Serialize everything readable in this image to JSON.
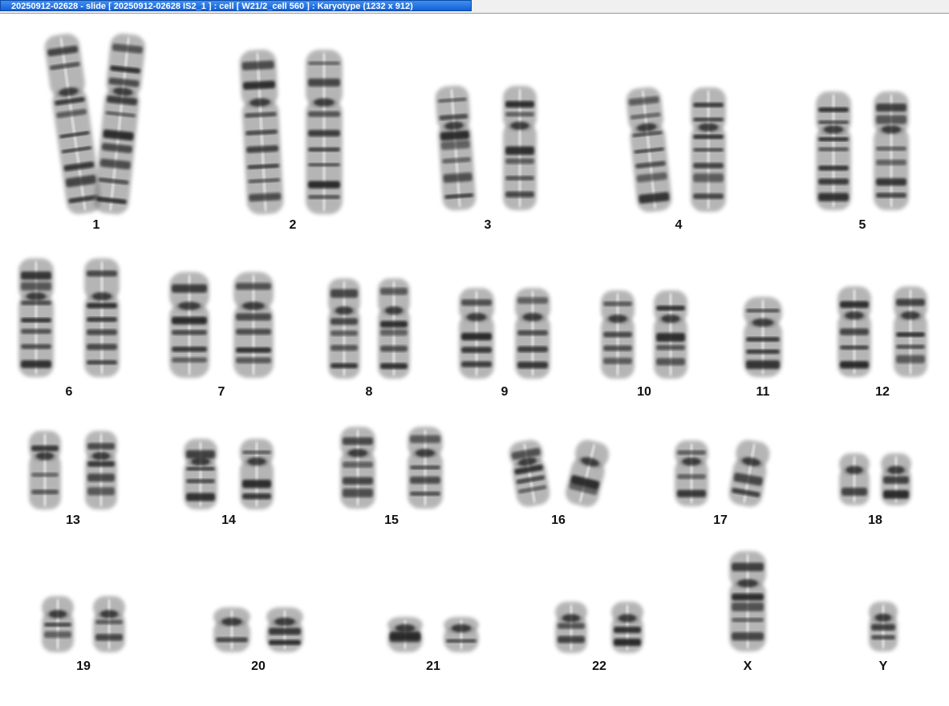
{
  "window": {
    "title": "20250912-02628 - slide [ 20250912-02628 IS2_1 ] : cell [ W21/2_cell 560 ] : Karyotype  (1232 x 912)"
  },
  "karyotype": {
    "chromosomes": [
      {
        "id": "1",
        "label": "1"
      },
      {
        "id": "2",
        "label": "2"
      },
      {
        "id": "3",
        "label": "3"
      },
      {
        "id": "4",
        "label": "4"
      },
      {
        "id": "5",
        "label": "5"
      },
      {
        "id": "6",
        "label": "6"
      },
      {
        "id": "7",
        "label": "7"
      },
      {
        "id": "8",
        "label": "8"
      },
      {
        "id": "9",
        "label": "9"
      },
      {
        "id": "10",
        "label": "10"
      },
      {
        "id": "11",
        "label": "11"
      },
      {
        "id": "12",
        "label": "12"
      },
      {
        "id": "13",
        "label": "13"
      },
      {
        "id": "14",
        "label": "14"
      },
      {
        "id": "15",
        "label": "15"
      },
      {
        "id": "16",
        "label": "16"
      },
      {
        "id": "17",
        "label": "17"
      },
      {
        "id": "18",
        "label": "18"
      },
      {
        "id": "19",
        "label": "19"
      },
      {
        "id": "20",
        "label": "20"
      },
      {
        "id": "21",
        "label": "21"
      },
      {
        "id": "22",
        "label": "22"
      },
      {
        "id": "X",
        "label": "X"
      },
      {
        "id": "Y",
        "label": "Y"
      }
    ]
  },
  "colors": {
    "title_bar": "#1a6ee0",
    "chromosome_fill": "#7a7a7a",
    "band_dark": "#1a1a1a"
  }
}
